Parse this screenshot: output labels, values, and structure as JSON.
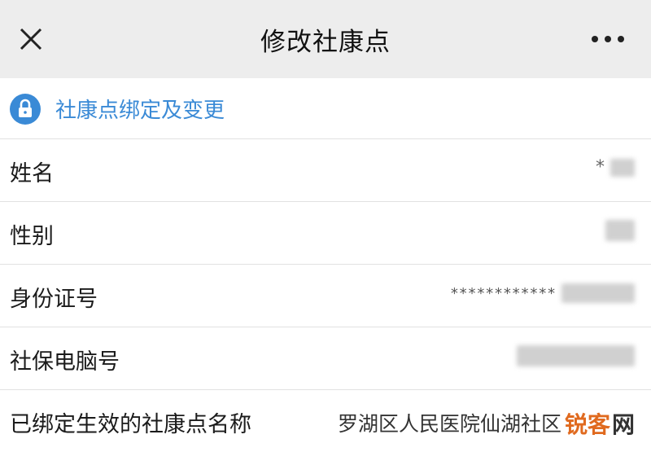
{
  "header": {
    "title": "修改社康点",
    "close_icon": "close-icon",
    "more_icon": "more-horizontal-icon"
  },
  "notice": {
    "icon": "lock-icon",
    "link_text": "社康点绑定及变更",
    "accent_color": "#3a8ad6"
  },
  "fields": [
    {
      "label": "姓名",
      "value": "*"
    },
    {
      "label": "性别",
      "value": ""
    },
    {
      "label": "身份证号",
      "value": "************"
    },
    {
      "label": "社保电脑号",
      "value": ""
    },
    {
      "label": "已绑定生效的社康点名称",
      "value": "罗湖区人民医院仙湖社区"
    }
  ],
  "watermark": {
    "text": "锐客",
    "suffix": "网"
  }
}
